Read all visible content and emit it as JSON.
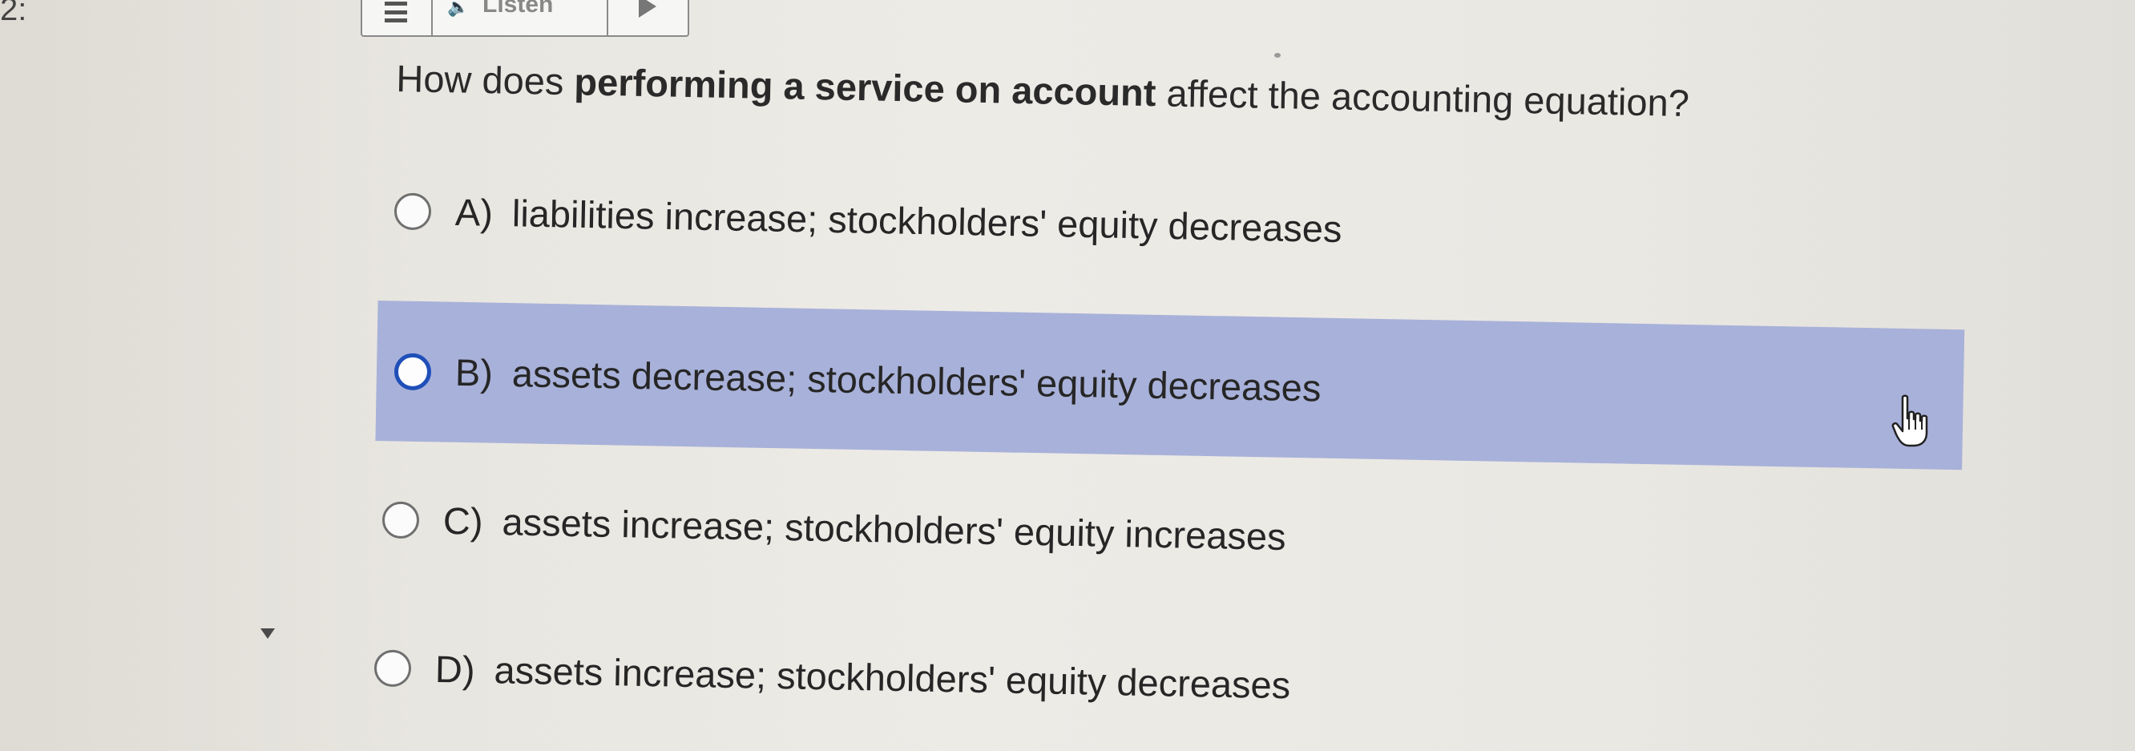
{
  "question_number": "2:",
  "listen_bar": {
    "label": "Listen",
    "menu_icon": "hamburger-icon",
    "speaker_icon": "speaker-icon",
    "play_icon": "play-icon"
  },
  "question": {
    "part1": "How does ",
    "bold": "performing a service on account",
    "part2": " affect the accounting equation?"
  },
  "options": [
    {
      "letter": "A)",
      "text": "liabilities increase; stockholders' equity decreases",
      "selected": false,
      "hovered": false
    },
    {
      "letter": "B)",
      "text": "assets decrease; stockholders' equity decreases",
      "selected": false,
      "hovered": true
    },
    {
      "letter": "C)",
      "text": "assets increase; stockholders' equity increases",
      "selected": false,
      "hovered": false
    },
    {
      "letter": "D)",
      "text": "assets increase; stockholders' equity decreases",
      "selected": false,
      "hovered": false
    }
  ],
  "colors": {
    "hover_highlight": "#a8b1d9",
    "radio_hover_border": "#1f4fb8",
    "text": "#262626"
  },
  "cursor_icon": "hand-pointer-icon"
}
